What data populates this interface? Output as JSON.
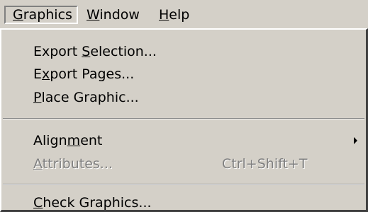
{
  "menubar": {
    "items": [
      {
        "label": "Graphics",
        "mnemonic_index": 0,
        "active": true
      },
      {
        "label": "Window",
        "mnemonic_index": 0,
        "active": false
      },
      {
        "label": "Help",
        "mnemonic_index": 0,
        "active": false
      }
    ]
  },
  "menu": {
    "items": [
      {
        "label": "Export Selection...",
        "mnemonic_index": 7,
        "enabled": true
      },
      {
        "label": "Export Pages...",
        "mnemonic_index": 1,
        "enabled": true
      },
      {
        "label": "Place Graphic...",
        "mnemonic_index": 0,
        "enabled": true
      },
      {
        "label": "Alignment",
        "mnemonic_index": 5,
        "enabled": true,
        "has_submenu": true
      },
      {
        "label": "Attributes...",
        "mnemonic_index": 0,
        "enabled": false,
        "shortcut": "Ctrl+Shift+T"
      },
      {
        "label": "Check Graphics...",
        "mnemonic_index": 0,
        "enabled": true
      }
    ]
  },
  "colors": {
    "menu_face": "#d4d0c8",
    "disabled_text": "#808080",
    "shadow": "#404040"
  },
  "icons": {
    "submenu_arrow": "triangle-right-icon"
  }
}
